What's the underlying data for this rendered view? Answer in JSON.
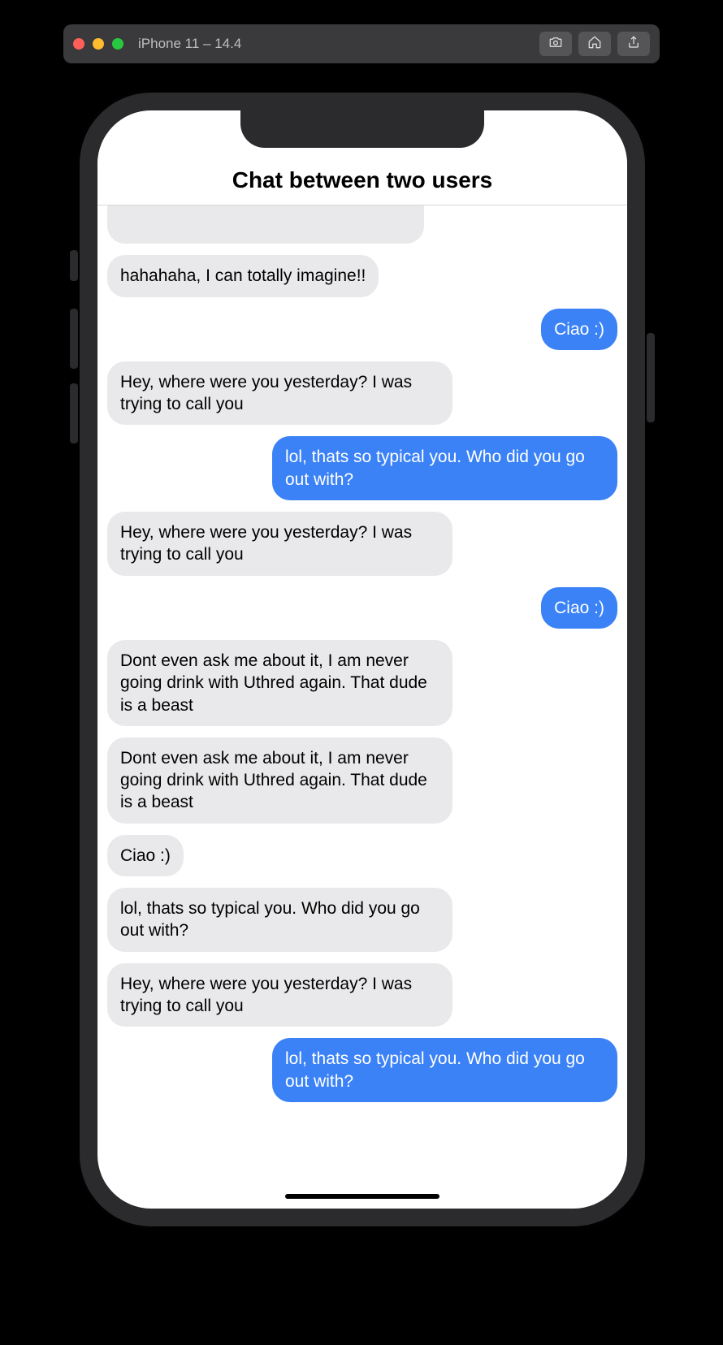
{
  "simulator": {
    "title": "iPhone 11 – 14.4",
    "buttons": {
      "screenshot": "Take Screenshot",
      "home": "Home",
      "share": "Share"
    }
  },
  "app": {
    "title": "Chat between two users"
  },
  "messages": [
    {
      "side": "left",
      "text": ""
    },
    {
      "side": "left",
      "text": "hahahaha, I can totally imagine!!"
    },
    {
      "side": "right",
      "text": "Ciao :)"
    },
    {
      "side": "left",
      "text": "Hey, where were you yesterday? I was trying to call you"
    },
    {
      "side": "right",
      "text": "lol, thats so typical you. Who did you go out with?"
    },
    {
      "side": "left",
      "text": "Hey, where were you yesterday? I was trying to call you"
    },
    {
      "side": "right",
      "text": "Ciao :)"
    },
    {
      "side": "left",
      "text": "Dont even ask me about it, I am never going drink with Uthred again. That dude is a beast"
    },
    {
      "side": "left",
      "text": "Dont even ask me about it, I am never going drink with Uthred again. That dude is a beast"
    },
    {
      "side": "left",
      "text": "Ciao :)"
    },
    {
      "side": "left",
      "text": "lol, thats so typical you. Who did you go out with?"
    },
    {
      "side": "left",
      "text": "Hey, where were you yesterday? I was trying to call you"
    },
    {
      "side": "right",
      "text": "lol, thats so typical you. Who did you go out with?"
    }
  ],
  "colors": {
    "sent_bubble": "#3b82f7",
    "received_bubble": "#e9e9eb",
    "titlebar": "#3a3a3c"
  }
}
